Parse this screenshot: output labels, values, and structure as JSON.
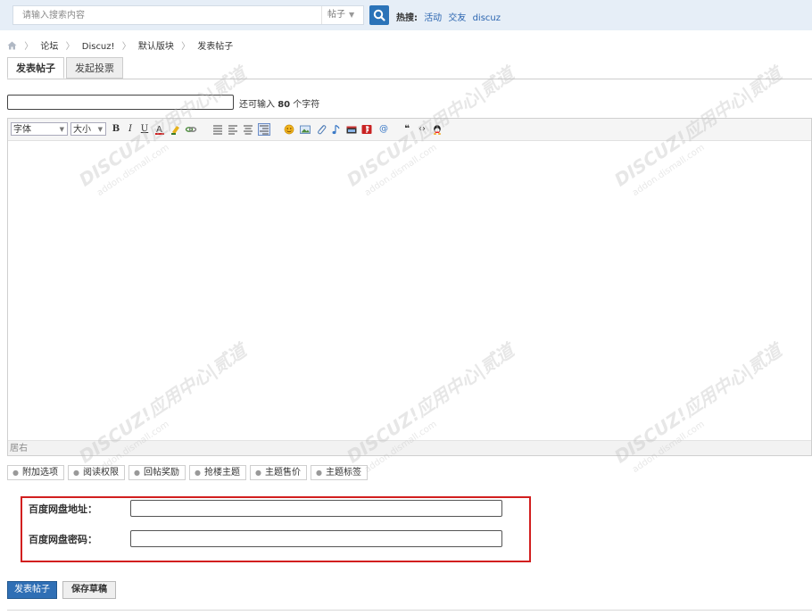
{
  "search": {
    "placeholder": "请输入搜索内容",
    "type_label": "帖子",
    "hot_label": "热搜:",
    "hot_links": [
      "活动",
      "交友",
      "discuz"
    ]
  },
  "breadcrumb": {
    "items": [
      "论坛",
      "Discuz!",
      "默认版块",
      "发表帖子"
    ]
  },
  "tabs": {
    "post": "发表帖子",
    "poll": "发起投票"
  },
  "subject": {
    "value": "",
    "hint_prefix": "还可输入",
    "hint_count": "80",
    "hint_suffix": "个字符"
  },
  "editor": {
    "font_select": "字体",
    "size_select": "大小",
    "status_text": "居右",
    "toolbar_icons": [
      "bold-icon",
      "italic-icon",
      "underline-icon",
      "font-color-icon",
      "highlight-icon",
      "link-icon",
      "align-left-icon",
      "align-center-icon",
      "align-right-icon",
      "align-justify-icon",
      "emoji-icon",
      "image-icon",
      "attachment-icon",
      "audio-icon",
      "video-icon",
      "flash-icon",
      "mention-icon",
      "quote-icon",
      "code-icon",
      "qq-icon"
    ]
  },
  "options": [
    "附加选项",
    "阅读权限",
    "回帖奖励",
    "抢楼主题",
    "主题售价",
    "主题标签"
  ],
  "extra_fields": {
    "baidu_url_label": "百度网盘地址：",
    "baidu_url_value": "",
    "baidu_pwd_label": "百度网盘密码：",
    "baidu_pwd_value": ""
  },
  "actions": {
    "post_label": "发表帖子",
    "draft_label": "保存草稿"
  },
  "watermark": {
    "brand": "DISCUZ!应用中心|贰道",
    "domain": "addon.dismall.com"
  },
  "colors": {
    "accent": "#2f6fb5",
    "highlight_border": "#d21f1f",
    "topbar_bg": "#e6eef7"
  }
}
